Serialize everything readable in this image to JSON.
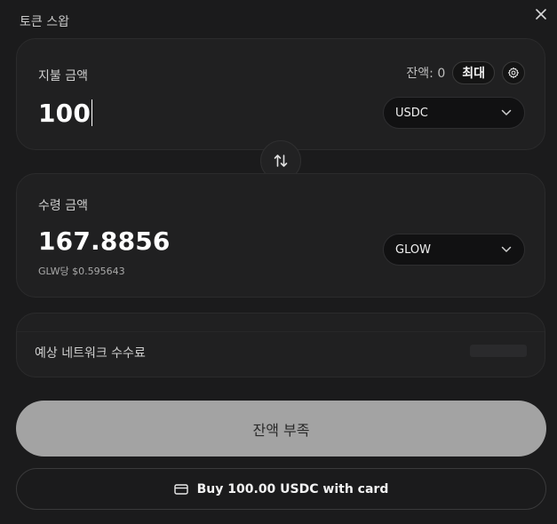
{
  "header": {
    "title": "토큰 스왑",
    "close_icon": "close-icon"
  },
  "pay": {
    "label": "지불 금액",
    "balance_label": "잔액: 0",
    "max_label": "최대",
    "amount": "100",
    "token": "USDC"
  },
  "receive": {
    "label": "수령 금액",
    "amount": "167.8856",
    "rate": "GLW당 $0.595643",
    "token": "GLOW"
  },
  "fee": {
    "label": "예상 네트워크 수수료"
  },
  "actions": {
    "primary_label": "잔액 부족",
    "card_label": "Buy 100.00 USDC with card"
  },
  "colors": {
    "background": "#1b1b1c",
    "panel": "#202021",
    "primary_button": "#a3a3a3"
  }
}
